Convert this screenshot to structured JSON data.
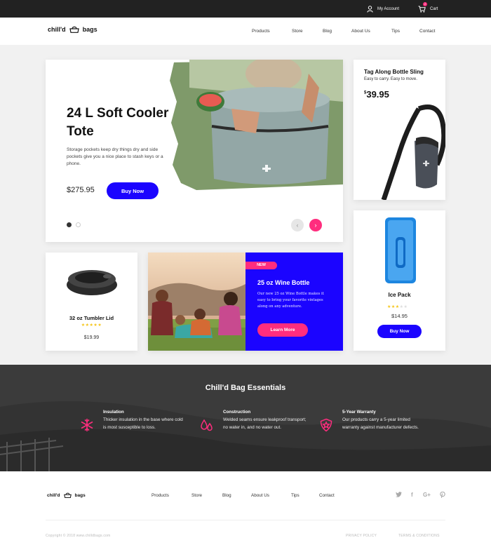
{
  "topbar": {
    "account_label": "My Account",
    "cart_label": "Cart",
    "cart_count": "2"
  },
  "brand": {
    "name_left": "chill'd",
    "name_right": "bags"
  },
  "nav": {
    "items": [
      "Products",
      "Store",
      "Blog",
      "About Us",
      "Tips",
      "Contact"
    ]
  },
  "hero": {
    "title": "24 L Soft Cooler Tote",
    "description": "Storage pockets keep dry things dry and side pockets give you a nice place to stash keys or a phone.",
    "price": "$275.95",
    "button": "Buy Now",
    "slide_current": 1,
    "slide_total": 2
  },
  "sling": {
    "title": "Tag Along Bottle Sling",
    "subtitle": "Easy to carry. Easy to move.",
    "currency": "$",
    "price": "39.95"
  },
  "lid": {
    "name": "32 oz Tumbler Lid",
    "stars": "★★★★★",
    "rating": 5,
    "price": "$19.99"
  },
  "wine": {
    "badge": "NEW",
    "title": "25 oz Wine Bottle",
    "description": "Our new 25 oz Wine Bottle makes it easy to bring your favorite vintages along on any adventure.",
    "button": "Learn More"
  },
  "ice": {
    "name": "Ice Pack",
    "stars_filled": "★★★",
    "stars_empty": "★★",
    "rating": 3,
    "price": "$14.95",
    "button": "Buy Now"
  },
  "essentials": {
    "heading": "Chill'd Bag Essentials",
    "features": [
      {
        "title": "Insulation",
        "text": "Thicker insulation in the base where cold is most susceptible to loss."
      },
      {
        "title": "Construction",
        "text": "Welded seams ensure leakproof transport; no water in, and no water out."
      },
      {
        "title": "5-Year Warranty",
        "text": "Our products carry a 5-year limited warranty against manufacturer defects."
      }
    ]
  },
  "footer": {
    "links": [
      "Products",
      "Store",
      "Blog",
      "About Us",
      "Tips",
      "Contact"
    ],
    "copyright": "Copyright © 2018 www.chilldbags.com",
    "privacy": "PRIVACY POLICY",
    "terms": "TERMS & CONDITIONS"
  },
  "colors": {
    "accent_blue": "#1b04ff",
    "accent_pink": "#ff2d7e",
    "dark": "#222222"
  }
}
